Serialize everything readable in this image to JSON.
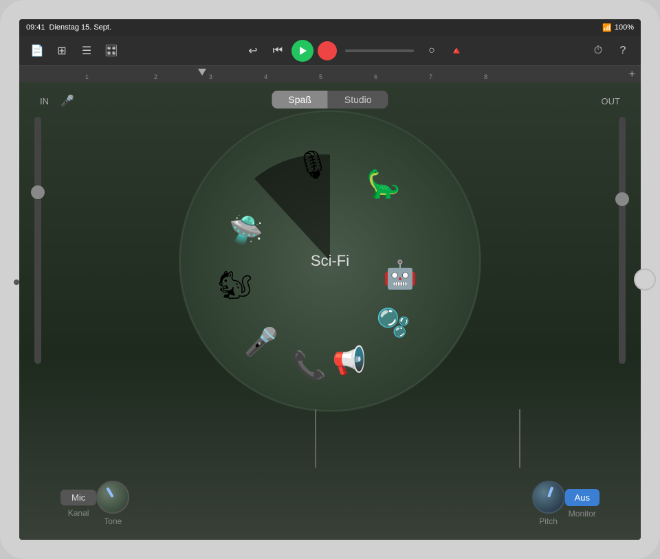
{
  "statusBar": {
    "time": "09:41",
    "date": "Dienstag 15. Sept.",
    "battery": "100%",
    "icons": [
      "wifi",
      "battery"
    ]
  },
  "toolbar": {
    "rewind_label": "⏮",
    "play_label": "▶",
    "record_label": "●",
    "undo_label": "↩",
    "settings_label": "⚙",
    "help_label": "?"
  },
  "ruler": {
    "marks": [
      "1",
      "2",
      "3",
      "4",
      "5",
      "6",
      "7",
      "8"
    ],
    "plus_label": "+"
  },
  "main": {
    "in_label": "IN",
    "out_label": "OUT",
    "mode": {
      "options": [
        "Spaß",
        "Studio"
      ],
      "active": "Spaß"
    },
    "wheel_label": "Sci-Fi",
    "voices": [
      {
        "name": "ufo",
        "emoji": "🛸",
        "angle": 210,
        "radius": 155
      },
      {
        "name": "microphone",
        "emoji": "🎙",
        "angle": 330,
        "radius": 145
      },
      {
        "name": "monster",
        "emoji": "🦕",
        "angle": 20,
        "radius": 155
      },
      {
        "name": "squirrel",
        "emoji": "🐿",
        "angle": 175,
        "radius": 155
      },
      {
        "name": "robot",
        "emoji": "🤖",
        "angle": 350,
        "radius": 155
      },
      {
        "name": "microphone2",
        "emoji": "🎤",
        "angle": 215,
        "radius": 155
      },
      {
        "name": "telephone",
        "emoji": "📞",
        "angle": 285,
        "radius": 155
      },
      {
        "name": "megaphone",
        "emoji": "📢",
        "angle": 308,
        "radius": 155
      },
      {
        "name": "bubbles",
        "emoji": "🫧",
        "angle": 15,
        "radius": 155
      }
    ]
  },
  "controls": {
    "mic_label": "Mic",
    "kanal_label": "Kanal",
    "tone_label": "Tone",
    "pitch_label": "Pitch",
    "monitor_label": "Aus",
    "monitor_sub": "Monitor"
  }
}
